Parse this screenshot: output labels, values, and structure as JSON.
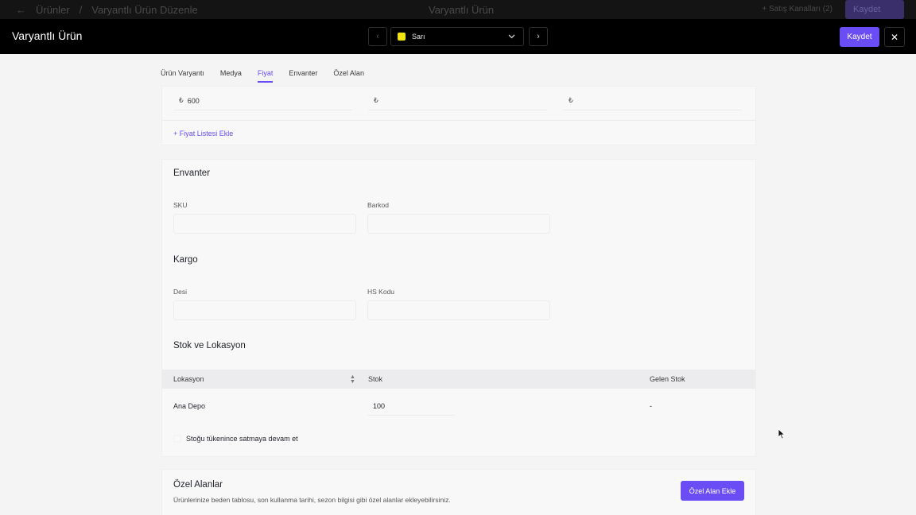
{
  "background": {
    "breadcrumb_back": "←",
    "breadcrumb_root": "Ürünler",
    "breadcrumb_sep": "/",
    "breadcrumb_current": "Varyantlı Ürün Düzenle",
    "center_title": "Varyantlı Ürün",
    "sales_channels": "+ Satış Kanalları (2)",
    "save_label": "Kaydet"
  },
  "header": {
    "title": "Varyantlı Ürün",
    "prev_icon": "‹",
    "next_icon": "›",
    "variant": {
      "swatch_color": "#f2e313",
      "label": "Sarı",
      "chevron": "⌄"
    },
    "save_label": "Kaydet",
    "close_icon": "✕"
  },
  "tabs": [
    {
      "label": "Ürün Varyantı",
      "active": false
    },
    {
      "label": "Medya",
      "active": false
    },
    {
      "label": "Fiyat",
      "active": true
    },
    {
      "label": "Envanter",
      "active": false
    },
    {
      "label": "Özel Alan",
      "active": false
    }
  ],
  "price": {
    "fields": [
      {
        "currency": "₺",
        "value": "600"
      },
      {
        "currency": "₺",
        "value": ""
      },
      {
        "currency": "₺",
        "value": ""
      }
    ],
    "add_price_list": "+ Fiyat Listesi Ekle"
  },
  "inventory": {
    "title": "Envanter",
    "sku_label": "SKU",
    "sku_value": "",
    "barcode_label": "Barkod",
    "barcode_value": ""
  },
  "cargo": {
    "title": "Kargo",
    "desi_label": "Desi",
    "desi_value": "",
    "hs_label": "HS Kodu",
    "hs_value": ""
  },
  "stock": {
    "title": "Stok ve Lokasyon",
    "columns": [
      "Lokasyon",
      "Stok",
      "Gelen Stok"
    ],
    "rows": [
      {
        "location": "Ana Depo",
        "stock": "100",
        "incoming": "-"
      }
    ],
    "continue_selling": "Stoğu tükenince satmaya devam et"
  },
  "custom_fields": {
    "title": "Özel Alanlar",
    "description": "Ürünlerinize beden tablosu, son kullanma tarihi, sezon bilgisi gibi özel alanlar ekleyebilirsiniz.",
    "button_label": "Özel Alan Ekle"
  },
  "colors": {
    "accent": "#6a4df5",
    "header_bg": "#000000"
  }
}
